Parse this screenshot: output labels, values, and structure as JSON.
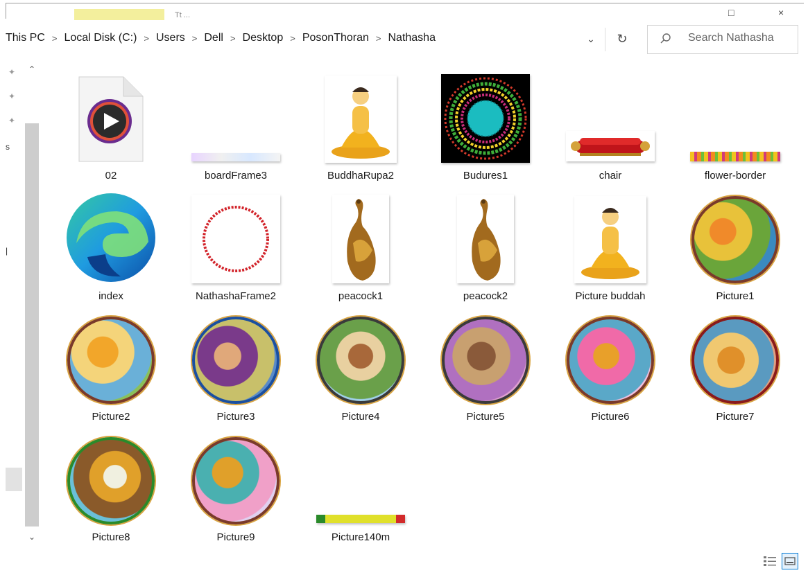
{
  "window": {
    "title_fragment": "Tt ..."
  },
  "breadcrumb": {
    "items": [
      "This PC",
      "Local Disk (C:)",
      "Users",
      "Dell",
      "Desktop",
      "PosonThoran",
      "Nathasha"
    ]
  },
  "search": {
    "placeholder": "Search Nathasha"
  },
  "icons": {
    "breadcrumb_separator": "chevron-right-icon",
    "dropdown": "chevron-down-icon",
    "refresh": "refresh-icon",
    "search": "search-icon",
    "pin": "pin-icon",
    "scroll_up": "scroll-up-icon",
    "scroll_down": "scroll-down-icon"
  },
  "files": [
    {
      "name": "02"
    },
    {
      "name": "boardFrame3"
    },
    {
      "name": "BuddhaRupa2"
    },
    {
      "name": "Budures1"
    },
    {
      "name": "chair"
    },
    {
      "name": "flower-border"
    },
    {
      "name": "index"
    },
    {
      "name": "NathashaFrame2"
    },
    {
      "name": "peacock1"
    },
    {
      "name": "peacock2"
    },
    {
      "name": "Picture buddah"
    },
    {
      "name": "Picture1"
    },
    {
      "name": "Picture2"
    },
    {
      "name": "Picture3"
    },
    {
      "name": "Picture4"
    },
    {
      "name": "Picture5"
    },
    {
      "name": "Picture6"
    },
    {
      "name": "Picture7"
    },
    {
      "name": "Picture8"
    },
    {
      "name": "Picture9"
    },
    {
      "name": "Picture140m"
    }
  ],
  "colors": {
    "accent": "#0078d4",
    "frame_border": "#7a3a2a",
    "gold": "#d9a441"
  }
}
